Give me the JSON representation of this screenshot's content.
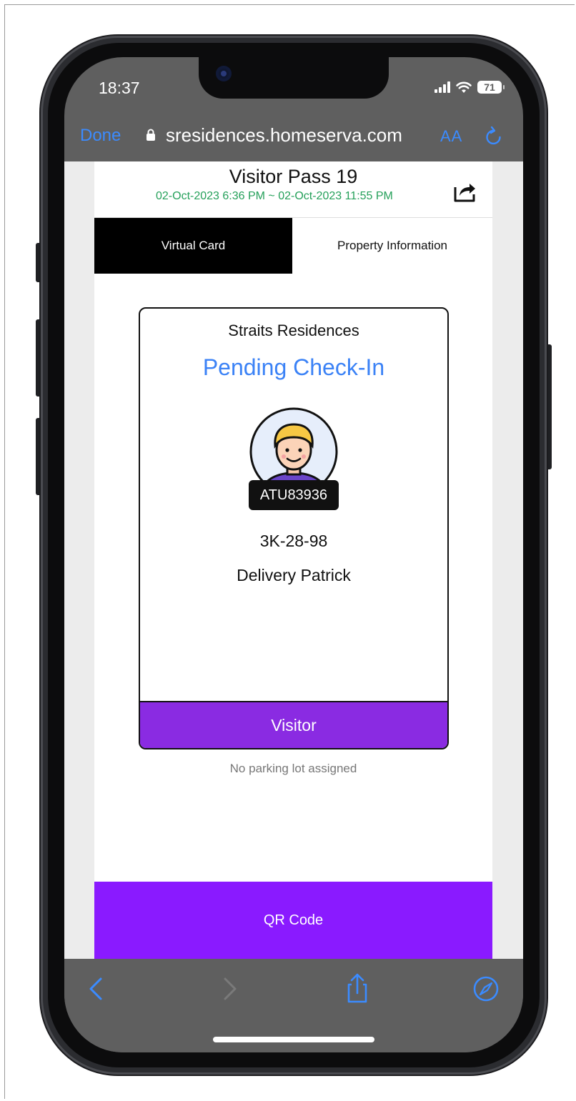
{
  "status_bar": {
    "time": "18:37",
    "battery": "71"
  },
  "browser": {
    "done_label": "Done",
    "url": "sresidences.homeserva.com",
    "text_size_label": "AA"
  },
  "pass": {
    "title": "Visitor Pass 19",
    "validity": "02-Oct-2023 6:36 PM ~ 02-Oct-2023 11:55 PM"
  },
  "tabs": [
    {
      "label": "Virtual Card",
      "active": true
    },
    {
      "label": "Property Information",
      "active": false
    }
  ],
  "card": {
    "property_name": "Straits Residences",
    "status": "Pending Check-In",
    "badge_code": "ATU83936",
    "unit": "3K-28-98",
    "visitor_name": "Delivery Patrick",
    "visitor_type": "Visitor"
  },
  "parking_note": "No parking lot assigned",
  "qr_button": "QR Code",
  "colors": {
    "accent_blue": "#3b82f6",
    "safari_blue": "#3b8bff",
    "date_green": "#25a05a",
    "visitor_purple": "#8a2be2",
    "qr_purple": "#8a1aff"
  },
  "icons": [
    "lock-icon",
    "reload-icon",
    "share-icon",
    "back-icon",
    "forward-icon",
    "share-sheet-icon",
    "compass-icon"
  ]
}
